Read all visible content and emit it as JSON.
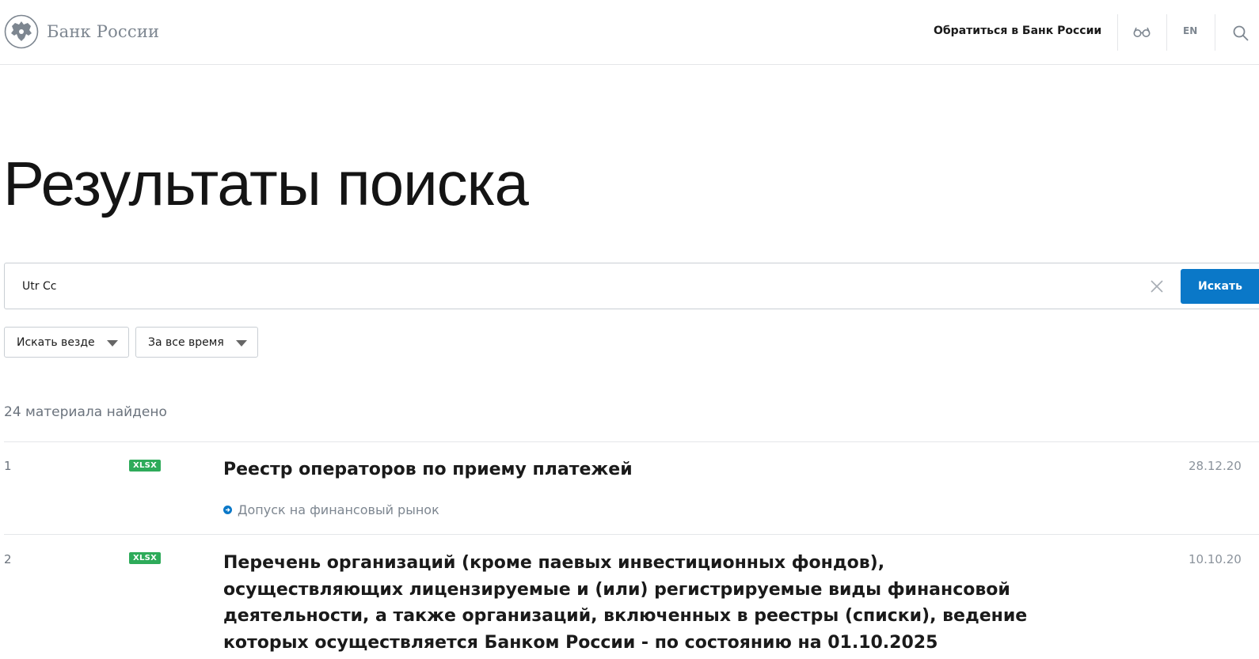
{
  "header": {
    "logo_text": "Банк России",
    "contact_link": "Обратиться в Банк России",
    "lang": "EN"
  },
  "page_title": "Результаты поиска",
  "search": {
    "value": "Utr Cc",
    "button_label": "Искать"
  },
  "filters": [
    {
      "label": "Искать везде"
    },
    {
      "label": "За все время"
    }
  ],
  "results_count": "24 материала найдено",
  "results": [
    {
      "num": "1",
      "badge": "XLSX",
      "title": "Реестр операторов по приему платежей",
      "date": "28.12.20",
      "tag": "Допуск на финансовый рынок"
    },
    {
      "num": "2",
      "badge": "XLSX",
      "title": "Перечень организаций (кроме паевых инвестиционных фондов), осуществляющих лицензируемые и (или) регистрируемые виды финансовой деятельности, а также организаций, включенных в реестры (списки), ведение которых осуществляется Банком России - по состоянию на 01.10.2025",
      "date": "10.10.20"
    }
  ],
  "colors": {
    "accent": "#0a78c8",
    "badge": "#2eab5a",
    "muted": "#7d8690"
  }
}
